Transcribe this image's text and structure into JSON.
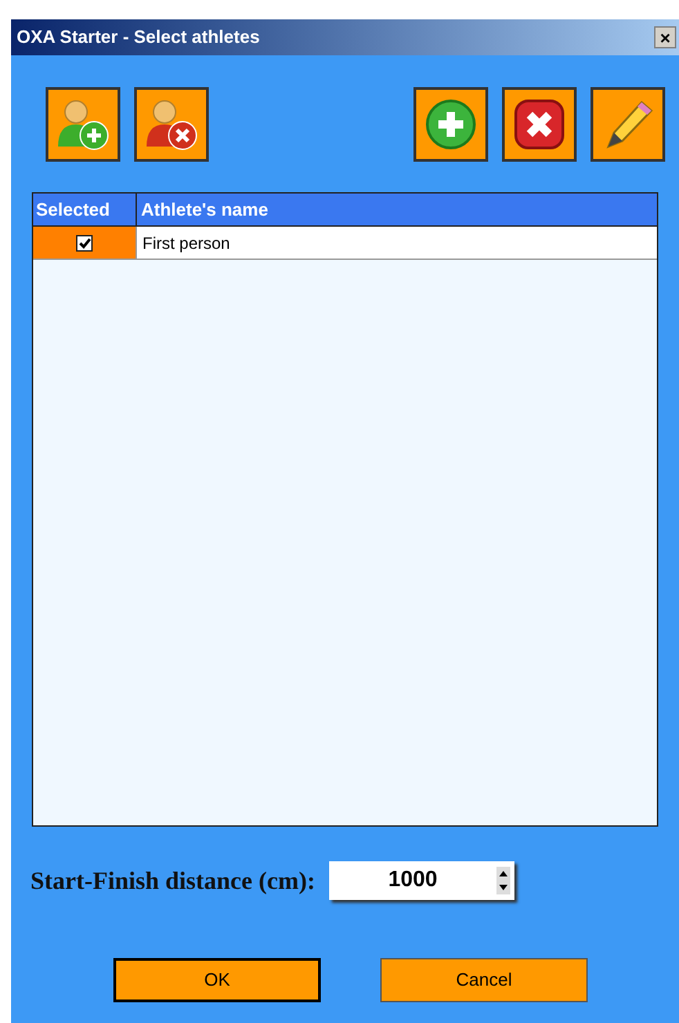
{
  "window": {
    "title": "OXA Starter - Select athletes",
    "close": "×"
  },
  "table": {
    "columns": [
      "Selected",
      "Athlete's name"
    ],
    "rows": [
      {
        "checked": true,
        "name": "First person"
      }
    ]
  },
  "distance": {
    "label": "Start-Finish distance (cm):",
    "value": "1000"
  },
  "buttons": [
    {
      "label": "OK",
      "default": true
    },
    {
      "label": "Cancel",
      "default": false
    }
  ]
}
